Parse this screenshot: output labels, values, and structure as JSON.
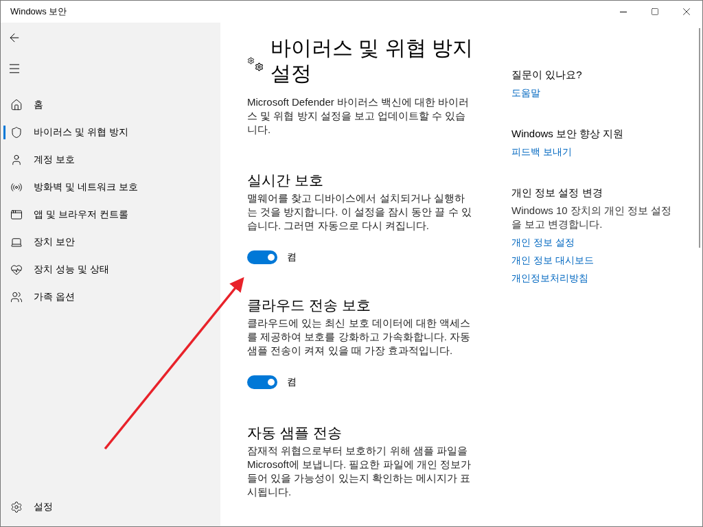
{
  "window": {
    "title": "Windows 보안"
  },
  "sidebar": {
    "items": [
      {
        "kind": "home",
        "label": "홈",
        "selected": false
      },
      {
        "kind": "shield",
        "label": "바이러스 및 위협 방지",
        "selected": true
      },
      {
        "kind": "person",
        "label": "계정 보호",
        "selected": false
      },
      {
        "kind": "antenna",
        "label": "방화벽 및 네트워크 보호",
        "selected": false
      },
      {
        "kind": "window",
        "label": "앱 및 브라우저 컨트롤",
        "selected": false
      },
      {
        "kind": "laptop",
        "label": "장치 보안",
        "selected": false
      },
      {
        "kind": "heart",
        "label": "장치 성능 및 상태",
        "selected": false
      },
      {
        "kind": "family",
        "label": "가족 옵션",
        "selected": false
      }
    ],
    "settings": {
      "label": "설정"
    }
  },
  "page": {
    "title": "바이러스 및 위협 방지 설정",
    "description": "Microsoft Defender 바이러스 백신에 대한 바이러스 및 위협 방지 설정을 보고 업데이트할 수 있습니다.",
    "sections": [
      {
        "title": "실시간 보호",
        "description": "맬웨어를 찾고 디바이스에서 설치되거나 실행하는 것을 방지합니다. 이 설정을 잠시 동안 끌 수 있습니다. 그러면 자동으로 다시 켜집니다.",
        "toggle": {
          "on": true,
          "label": "켬"
        }
      },
      {
        "title": "클라우드 전송 보호",
        "description": "클라우드에 있는 최신 보호 데이터에 대한 액세스를 제공하여 보호를 강화하고 가속화합니다. 자동 샘플 전송이 켜져 있을 때 가장 효과적입니다.",
        "toggle": {
          "on": true,
          "label": "켬"
        }
      },
      {
        "title": "자동 샘플 전송",
        "description": "잠재적 위협으로부터 보호하기 위해 샘플 파일을 Microsoft에 보냅니다. 필요한 파일에 개인 정보가 들어 있을 가능성이 있는지 확인하는 메시지가 표시됩니다."
      }
    ]
  },
  "aside": {
    "groups": [
      {
        "heading": "질문이 있나요?",
        "links": [
          "도움말"
        ]
      },
      {
        "heading": "Windows 보안 향상 지원",
        "links": [
          "피드백 보내기"
        ]
      },
      {
        "heading": "개인 정보 설정 변경",
        "text": "Windows 10 장치의 개인 정보 설정을 보고 변경합니다.",
        "links": [
          "개인 정보 설정",
          "개인 정보 대시보드",
          "개인정보처리방침"
        ]
      }
    ]
  }
}
